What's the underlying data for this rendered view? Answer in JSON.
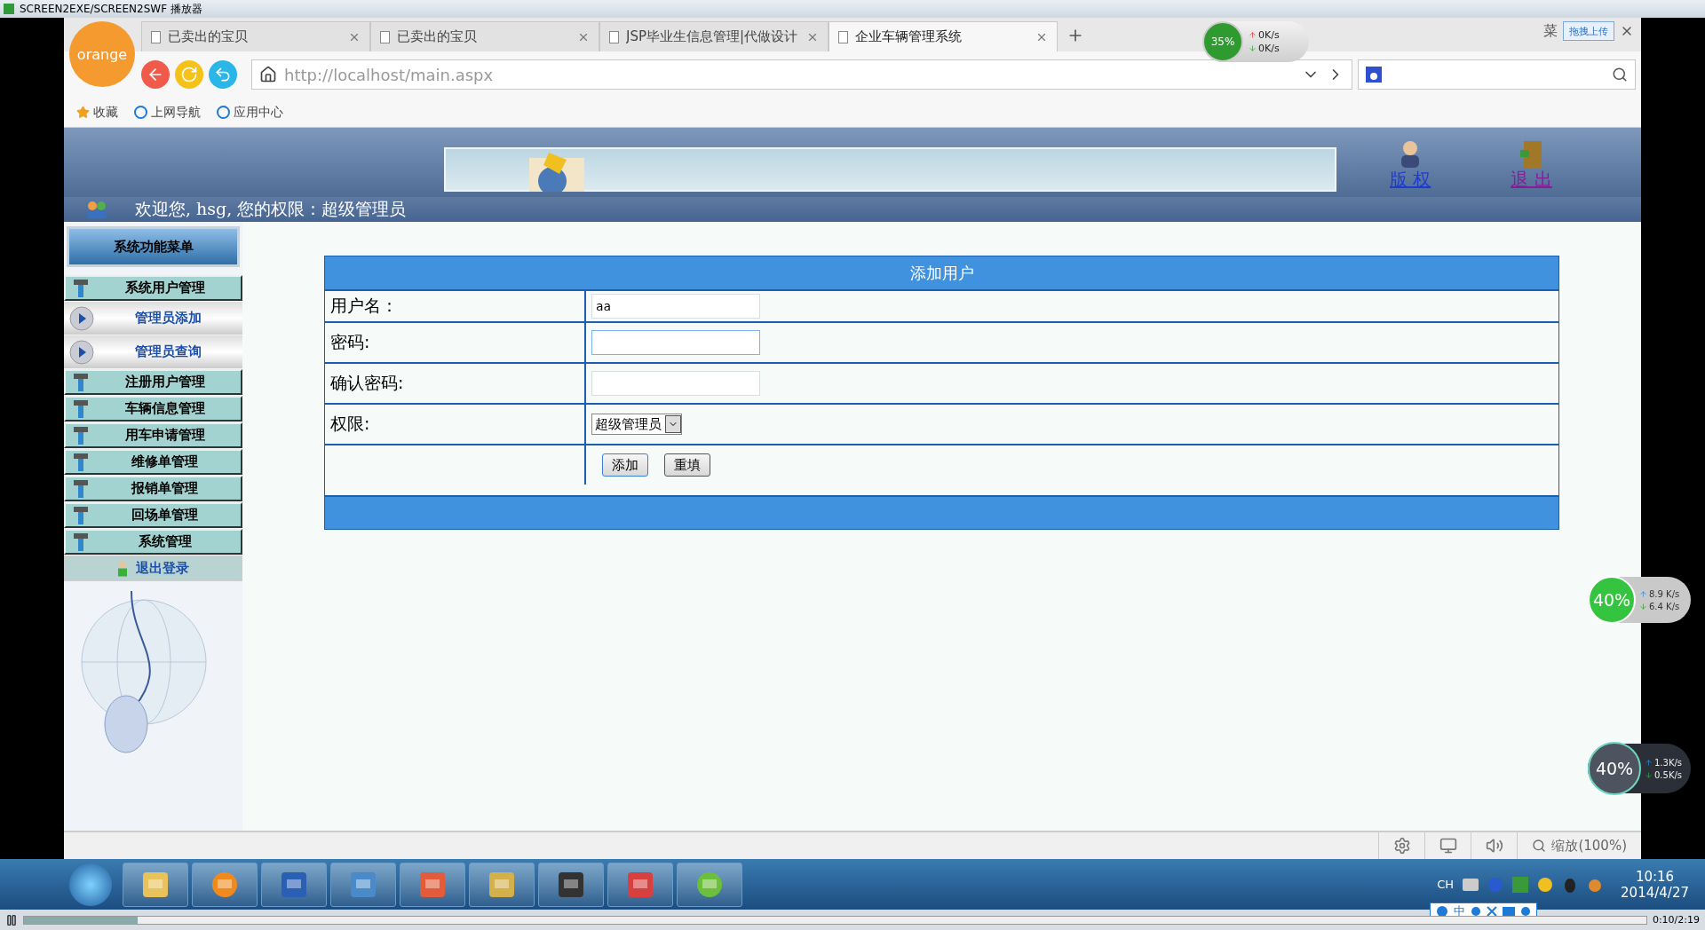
{
  "player": {
    "title": "SCREEN2EXE/SCREEN2SWF 播放器",
    "time": "0:10/2:19",
    "level": 0.07
  },
  "browser": {
    "logo": "orange",
    "tabs": [
      {
        "label": "已卖出的宝贝",
        "selected": false
      },
      {
        "label": "已卖出的宝贝",
        "selected": false
      },
      {
        "label": "JSP毕业生信息管理|代做设计",
        "selected": false
      },
      {
        "label": "企业车辆管理系统",
        "selected": true
      }
    ],
    "speed": {
      "percent": "35%",
      "up": "0K/s",
      "down": "0K/s"
    },
    "menu_partial": "菜",
    "upload_button": "拖拽上传",
    "address": "http://localhost/main.aspx",
    "bookmarks": [
      "收藏",
      "上网导航",
      "应用中心"
    ],
    "zoom": "缩放(100%)"
  },
  "page": {
    "header_links": [
      "版 权",
      "退 出"
    ],
    "welcome": "欢迎您, hsg, 您的权限：超级管理员",
    "menu_title": "系统功能菜单",
    "menu": [
      {
        "label": "系统用户管理",
        "children": [
          {
            "label": "管理员添加"
          },
          {
            "label": "管理员查询"
          }
        ]
      },
      {
        "label": "注册用户管理"
      },
      {
        "label": "车辆信息管理"
      },
      {
        "label": "用车申请管理"
      },
      {
        "label": "维修单管理"
      },
      {
        "label": "报销单管理"
      },
      {
        "label": "回场单管理"
      },
      {
        "label": "系统管理"
      }
    ],
    "logout": "退出登录",
    "form": {
      "title": "添加用户",
      "rows": [
        {
          "kind": "text",
          "label": "用户名：",
          "value": "aa",
          "focused": false
        },
        {
          "kind": "password",
          "label": "密码:",
          "focused": true
        },
        {
          "kind": "password",
          "label": "确认密码:",
          "focused": false
        },
        {
          "kind": "select",
          "label": "权限:",
          "value": "超级管理员"
        }
      ],
      "buttons": [
        "添加",
        "重填"
      ]
    }
  },
  "widgets": [
    {
      "kind": "light",
      "percent": "40%",
      "up": "8.9 K/s",
      "down": "6.4 K/s"
    },
    {
      "kind": "dark",
      "percent": "40%",
      "up": "1.3K/s",
      "down": "0.5K/s"
    }
  ],
  "taskbar": {
    "lang": "CH",
    "ime": "中",
    "time": "10:16",
    "date": "2014/4/27"
  }
}
